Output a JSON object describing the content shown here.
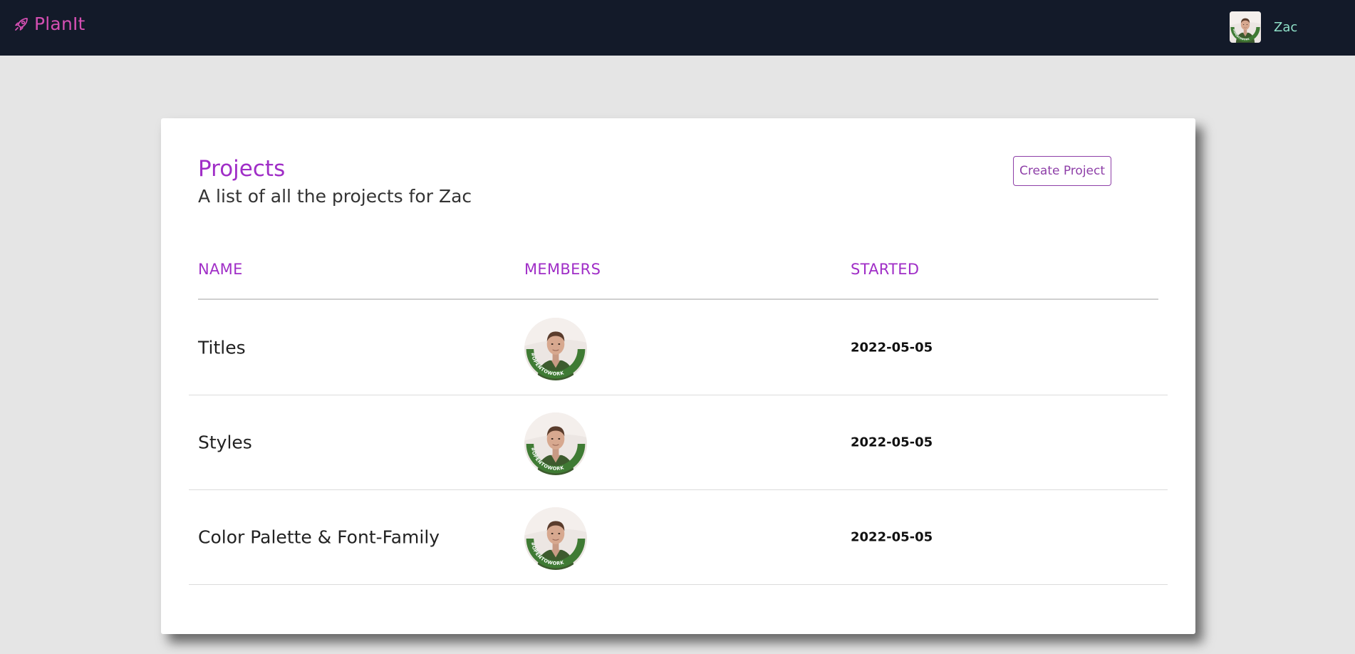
{
  "app": {
    "brand": "PlanIt",
    "brand_color": "#d44fb2",
    "nav_background": "#131a29",
    "brand_icon": "rocket-icon"
  },
  "user": {
    "name": "Zac",
    "avatar_icon": "user-avatar"
  },
  "page": {
    "title": "Projects",
    "subtitle": "A list of all the projects for Zac",
    "create_button": "Create Project",
    "accent_color": "#a02ec7"
  },
  "table": {
    "columns": [
      "NAME",
      "MEMBERS",
      "STARTED"
    ],
    "rows": [
      {
        "name": "Titles",
        "members": [
          "Zac"
        ],
        "started": "2022-05-05"
      },
      {
        "name": "Styles",
        "members": [
          "Zac"
        ],
        "started": "2022-05-05"
      },
      {
        "name": "Color Palette & Font-Family",
        "members": [
          "Zac"
        ],
        "started": "2022-05-05"
      }
    ]
  }
}
